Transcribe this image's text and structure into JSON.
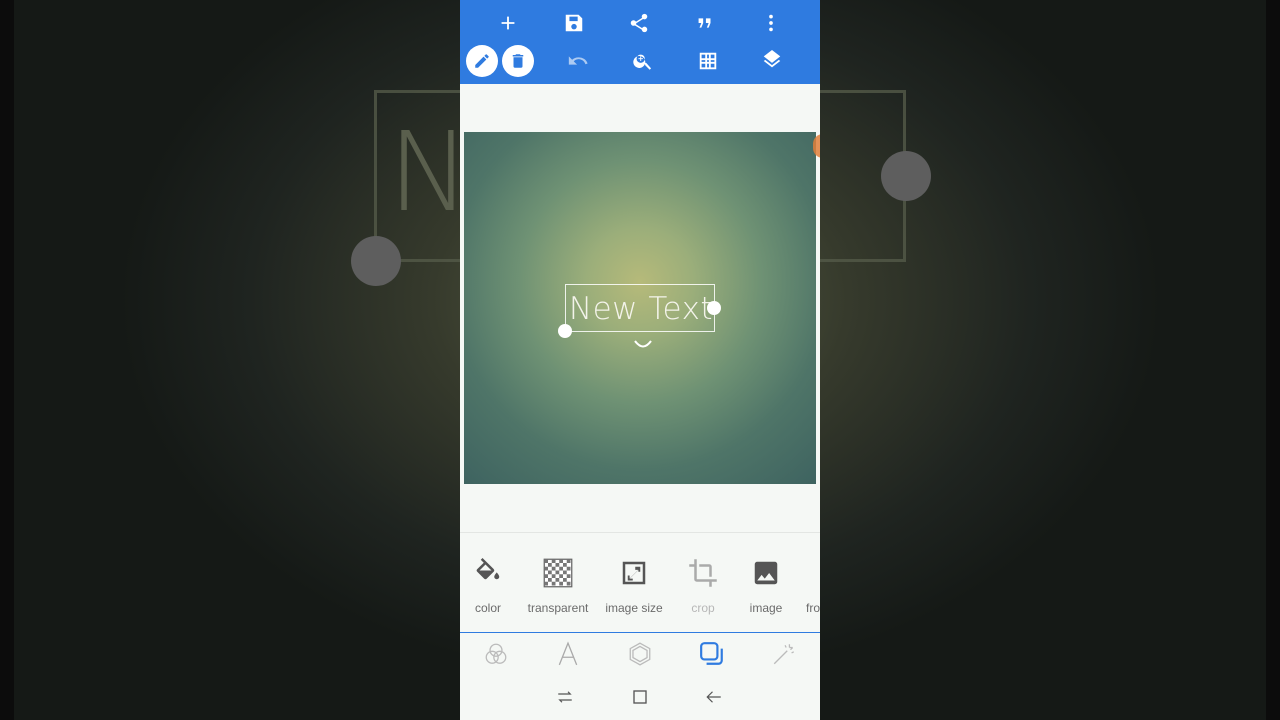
{
  "canvas": {
    "text_layer": "New Text"
  },
  "background_ghost_text": "Ne     xt",
  "toolbar": {
    "top_row": [
      "add-icon",
      "save-icon",
      "share-icon",
      "quote-icon",
      "more-vert-icon"
    ],
    "bottom_row": [
      "edit-icon",
      "delete-icon",
      "undo-icon",
      "zoom-in-icon",
      "grid-icon",
      "layers-icon"
    ]
  },
  "tools": [
    {
      "label": "color",
      "icon": "paint-bucket-icon"
    },
    {
      "label": "transparent",
      "icon": "checkerboard-icon"
    },
    {
      "label": "image size",
      "icon": "resize-icon"
    },
    {
      "label": "crop",
      "icon": "crop-icon"
    },
    {
      "label": "image",
      "icon": "image-icon"
    },
    {
      "label": "fro",
      "icon": ""
    }
  ],
  "tabs": [
    {
      "icon": "color-circles-icon",
      "active": false
    },
    {
      "icon": "text-a-icon",
      "active": false
    },
    {
      "icon": "hexagon-icon",
      "active": false
    },
    {
      "icon": "layers-square-icon",
      "active": true
    },
    {
      "icon": "magic-wand-icon",
      "active": false
    }
  ],
  "navigation": [
    "recent-apps-icon",
    "home-icon",
    "back-icon"
  ],
  "colors": {
    "toolbar": "#2f7be0",
    "accent": "#2f7be0",
    "background": "#f5f8f5"
  }
}
